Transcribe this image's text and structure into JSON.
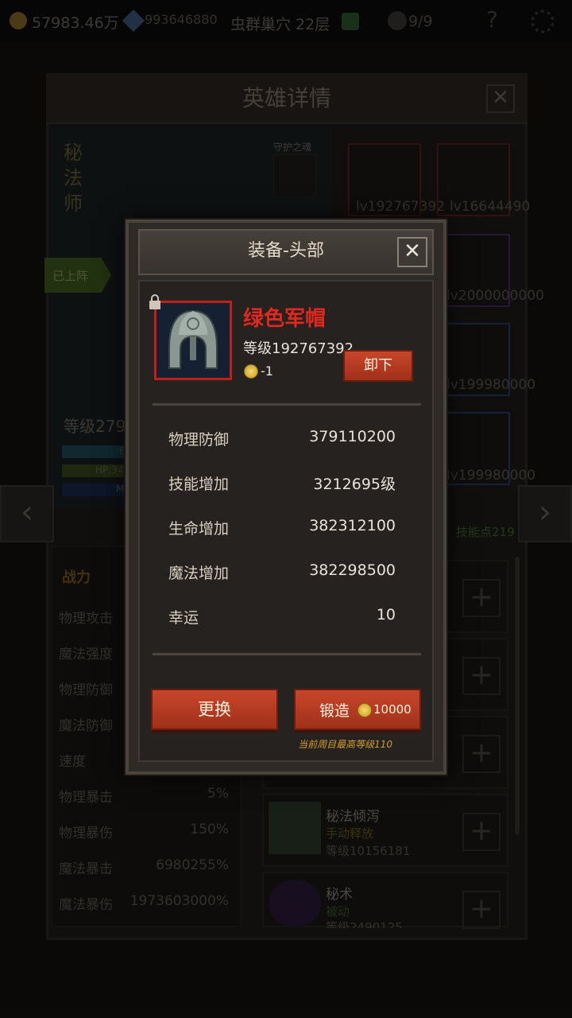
{
  "topbar": {
    "gold": "57983.46万",
    "gems": "993646880",
    "stage": "虫群巢穴 22层",
    "skull": "9/9",
    "help": "?"
  },
  "background_panel": {
    "title": "英雄详情",
    "close": "✕",
    "hero_class": "秘法师",
    "guardian_label": "守护之魂",
    "deployed_label": "已上阵",
    "hero_level": "等级279",
    "hp_label": "HP:34",
    "exp_label": "E",
    "mp_label": "M",
    "skill_points": "技能点219",
    "equip_levels": [
      "lv192767392",
      "lv16644490",
      "lv2000000000",
      "lv199980000",
      "lv199980000"
    ],
    "left_arrow": "‹",
    "right_arrow": "›",
    "stats_header": "战力",
    "stats": [
      {
        "label": "物理攻击",
        "value": ""
      },
      {
        "label": "魔法强度",
        "value": ""
      },
      {
        "label": "物理防御",
        "value": ""
      },
      {
        "label": "魔法防御",
        "value": ""
      },
      {
        "label": "速度",
        "value": ""
      },
      {
        "label": "物理暴击",
        "value": "5%"
      },
      {
        "label": "物理暴伤",
        "value": "150%"
      },
      {
        "label": "魔法暴击",
        "value": "6980255%"
      },
      {
        "label": "魔法暴伤",
        "value": "1973603000%"
      }
    ],
    "skills": [
      {
        "name": "秘法倾泻",
        "type": "手动释放",
        "level": "等级10156181"
      },
      {
        "name": "秘术",
        "type": "被动",
        "level": "等级2490125"
      }
    ],
    "plus": "+"
  },
  "modal": {
    "title": "装备-头部",
    "close": "✕",
    "item_name": "绿色军帽",
    "item_level": "等级192767392",
    "item_cost": "-1",
    "unequip_label": "卸下",
    "stats": [
      {
        "label": "物理防御",
        "value": "379110200"
      },
      {
        "label": "技能增加",
        "value": "3212695级"
      },
      {
        "label": "生命增加",
        "value": "382312100"
      },
      {
        "label": "魔法增加",
        "value": "382298500"
      },
      {
        "label": "幸运",
        "value": "10"
      }
    ],
    "replace_label": "更换",
    "forge_label": "锻造",
    "forge_cost": "10000",
    "max_level_note": "当前周目最高等级110"
  },
  "colors": {
    "item_name": "#e0281f",
    "button_red": "#c8462a",
    "note_orange": "#d29a2a",
    "rarity_frame": "#c0201d"
  }
}
